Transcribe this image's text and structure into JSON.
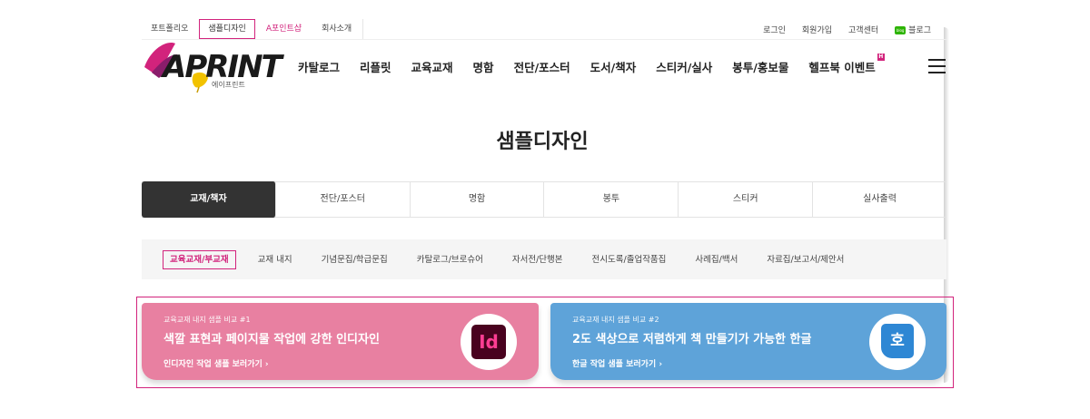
{
  "utility_left": [
    {
      "label": "포트폴리오"
    },
    {
      "label": "샘플디자인"
    },
    {
      "label": "A포인트샵"
    },
    {
      "label": "회사소개"
    }
  ],
  "utility_right": [
    {
      "label": "로그인"
    },
    {
      "label": "회원가입"
    },
    {
      "label": "고객센터"
    },
    {
      "label": "블로그"
    }
  ],
  "blog_badge": "blog",
  "logo": {
    "text": "APRINT",
    "sub": "에이프린트",
    "icon": "ginkgo-leaf-logo-icon"
  },
  "gnb": [
    {
      "label": "카탈로그"
    },
    {
      "label": "리플릿"
    },
    {
      "label": "교육교재"
    },
    {
      "label": "명함"
    },
    {
      "label": "전단/포스터"
    },
    {
      "label": "도서/책자"
    },
    {
      "label": "스티커/실사"
    },
    {
      "label": "봉투/홍보물"
    },
    {
      "label": "헬프북 이벤트"
    }
  ],
  "hot_badge": "H",
  "page_title": "샘플디자인",
  "tabs": [
    {
      "label": "교재/책자"
    },
    {
      "label": "전단/포스터"
    },
    {
      "label": "명함"
    },
    {
      "label": "봉투"
    },
    {
      "label": "스티커"
    },
    {
      "label": "실사출력"
    }
  ],
  "subtabs": [
    {
      "label": "교육교재/부교재"
    },
    {
      "label": "교재 내지"
    },
    {
      "label": "기념문집/학급문집"
    },
    {
      "label": "카탈로그/브로슈어"
    },
    {
      "label": "자서전/단행본"
    },
    {
      "label": "전시도록/졸업작품집"
    },
    {
      "label": "사례집/백서"
    },
    {
      "label": "자료집/보고서/제안서"
    }
  ],
  "banners": [
    {
      "small": "교육교재 내지 샘플 비교 #1",
      "title": "색깔 표현과 페이지물 작업에 강한 인디자인",
      "link": "인디자인 작업 샘플 보러가기 ›",
      "icon_text": "Id",
      "color": "#e880a1"
    },
    {
      "small": "교육교재 내지 샘플 비교 #2",
      "title": "2도 색상으로 저렴하게 책 만들기가 가능한 한글",
      "link": "한글 작업 샘플 보러가기 ›",
      "icon_text": "호",
      "color": "#5ea3d9"
    }
  ],
  "colors": {
    "accent": "#d2237c",
    "tab_active": "#333333"
  }
}
